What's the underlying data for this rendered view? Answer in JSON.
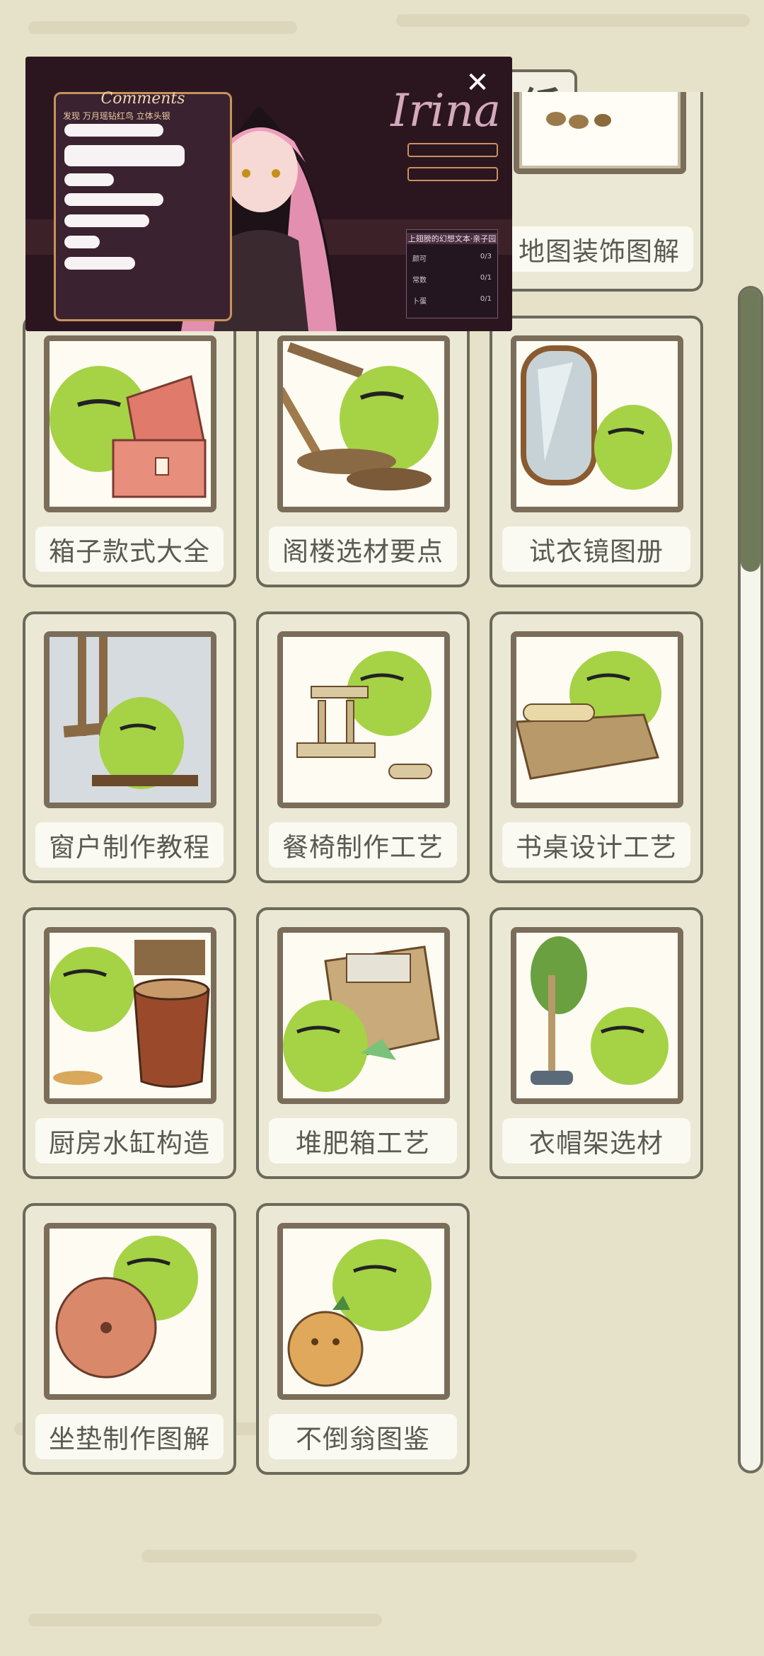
{
  "header": {
    "tab_char": "纸"
  },
  "top_card": {
    "label": "地图装饰图解"
  },
  "cards": [
    {
      "label": "箱子款式大全"
    },
    {
      "label": "阁楼选材要点"
    },
    {
      "label": "试衣镜图册"
    },
    {
      "label": "窗户制作教程"
    },
    {
      "label": "餐椅制作工艺"
    },
    {
      "label": "书桌设计工艺"
    },
    {
      "label": "厨房水缸构造"
    },
    {
      "label": "堆肥箱工艺"
    },
    {
      "label": "衣帽架选材"
    },
    {
      "label": "坐垫制作图解"
    },
    {
      "label": "不倒翁图鉴"
    }
  ],
  "ad": {
    "comments_title": "Comments",
    "tabs_text": "发现   万月瑶钻红鸟   立体头银",
    "logo_text": "Irina",
    "close_glyph": "✕",
    "stats_title": "上翅膀的幻想文本·亲子园",
    "stats": [
      {
        "name": "颜可",
        "value": "0/3"
      },
      {
        "name": "常数",
        "value": "0/1"
      },
      {
        "name": "卜蛋",
        "value": "0/1"
      }
    ]
  },
  "colors": {
    "background": "#e6e2c9",
    "card_border": "#6b6a5a",
    "frog_green": "#a6d246",
    "frame_brown": "#7a6d5a",
    "scroll_thumb": "#6f7a5a"
  },
  "icons": {
    "close": "close-icon"
  }
}
